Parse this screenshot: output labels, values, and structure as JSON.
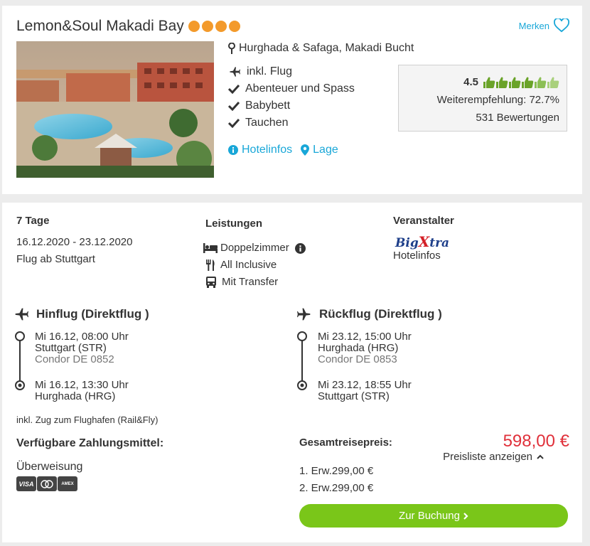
{
  "hotel": {
    "name": "Lemon&Soul Makadi Bay",
    "stars": 4,
    "location": "Hurghada & Safaga, Makadi Bucht",
    "features": [
      "inkl. Flug",
      "Abenteuer und Spass",
      "Babybett",
      "Tauchen"
    ],
    "links": {
      "hotelinfos": "Hotelinfos",
      "lage": "Lage"
    },
    "merken_label": "Merken"
  },
  "rating": {
    "score": "4.5",
    "thumbs_filled": 4.5,
    "thumbs_total": 6,
    "recommendation": "Weiterempfehlung: 72.7%",
    "reviews": "531 Bewertungen"
  },
  "offer": {
    "duration": "7 Tage",
    "dates": "16.12.2020 - 23.12.2020",
    "departure": "Flug ab Stuttgart",
    "services_title": "Leistungen",
    "services": [
      "Doppelzimmer",
      "All Inclusive",
      "Mit Transfer"
    ],
    "operator_title": "Veranstalter",
    "operator_logo": {
      "part1": "Big",
      "part2": "X",
      "part3": "tra"
    },
    "operator_link": "Hotelinfos"
  },
  "outbound": {
    "title": "Hinflug (Direktflug )",
    "dep_time": "Mi 16.12, 08:00 Uhr",
    "dep_airport": "Stuttgart (STR)",
    "flight": "Condor DE 0852",
    "arr_time": "Mi 16.12, 13:30 Uhr",
    "arr_airport": "Hurghada (HRG)"
  },
  "return": {
    "title": "Rückflug (Direktflug )",
    "dep_time": "Mi 23.12, 15:00 Uhr",
    "dep_airport": "Hurghada (HRG)",
    "flight": "Condor DE 0853",
    "arr_time": "Mi 23.12, 18:55 Uhr",
    "arr_airport": "Stuttgart (STR)"
  },
  "rail_note": "inkl. Zug zum Flughafen (Rail&Fly)",
  "payment": {
    "title": "Verfügbare Zahlungsmittel:",
    "method": "Überweisung",
    "cards": [
      "VISA",
      "MC",
      "AMEX"
    ]
  },
  "price": {
    "title": "Gesamtreisepreis:",
    "total": "598,00 €",
    "toggle": "Preisliste anzeigen",
    "lines": [
      "1. Erw.299,00 €",
      "2. Erw.299,00 €"
    ],
    "book_label": "Zur Buchung"
  },
  "colors": {
    "accent": "#19a7d8",
    "stars": "#f39a2b",
    "price": "#e0303a",
    "button": "#7ac619",
    "thumb": "#7cb342"
  }
}
